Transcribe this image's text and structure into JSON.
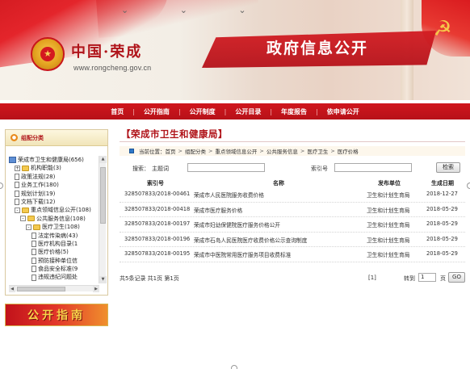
{
  "header": {
    "site_name": "中国·荣成",
    "site_url": "www.rongcheng.gov.cn",
    "banner_title": "政府信息公开"
  },
  "nav": [
    "首页",
    "公开指南",
    "公开制度",
    "公开目录",
    "年度报告",
    "依申请公开"
  ],
  "sidebar": {
    "title": "组配分类",
    "tree": [
      {
        "label": "荣成市卫生和健康局(656)",
        "icon": "root",
        "indent": 0
      },
      {
        "label": "机构职能(3)",
        "icon": "folder",
        "indent": 1,
        "exp": "+"
      },
      {
        "label": "政策法规(28)",
        "icon": "doc",
        "indent": 1
      },
      {
        "label": "业务工作(180)",
        "icon": "doc",
        "indent": 1
      },
      {
        "label": "规划计划(19)",
        "icon": "doc",
        "indent": 1
      },
      {
        "label": "文档下载(12)",
        "icon": "doc",
        "indent": 1
      },
      {
        "label": "重点领域信息公开(108)",
        "icon": "folder",
        "indent": 1,
        "exp": "-"
      },
      {
        "label": "公共服务信息(108)",
        "icon": "folder",
        "indent": 2,
        "exp": "-"
      },
      {
        "label": "医疗卫生(108)",
        "icon": "folder",
        "indent": 3,
        "exp": "-"
      },
      {
        "label": "法定传染病(43)",
        "icon": "doc",
        "indent": 4
      },
      {
        "label": "医疗机构目录(1",
        "icon": "doc",
        "indent": 4
      },
      {
        "label": "医疗价格(5)",
        "icon": "doc",
        "indent": 4
      },
      {
        "label": "预防接种单位信",
        "icon": "doc",
        "indent": 4
      },
      {
        "label": "食品安全标准(9",
        "icon": "doc",
        "indent": 4
      },
      {
        "label": "违规违纪问题处",
        "icon": "doc",
        "indent": 4
      }
    ],
    "guide_banner": "公开指南"
  },
  "main": {
    "title": "【荣成市卫生和健康局】",
    "breadcrumb": {
      "prefix": "当前位置：",
      "items": [
        "首页",
        "组配分类",
        "重点领域信息公开",
        "公共服务信息",
        "医疗卫生",
        "医疗价格"
      ]
    },
    "search": {
      "label": "搜索：",
      "subject_label": "主题词",
      "index_label": "索引号",
      "button": "检索"
    },
    "table": {
      "headers": [
        "索引号",
        "名称",
        "发布单位",
        "生成日期"
      ],
      "rows": [
        [
          "328507833/2018-00461",
          "荣成市人民医院服务收费价格",
          "卫生和计划生育局",
          "2018-12-27"
        ],
        [
          "328507833/2018-00418",
          "荣成市医疗服务价格",
          "卫生和计划生育局",
          "2018-05-29"
        ],
        [
          "328507833/2018-00197",
          "荣成市妇幼保健院医疗服务价格公开",
          "卫生和计划生育局",
          "2018-05-29"
        ],
        [
          "328507833/2018-00196",
          "荣成市石岛人民医院医疗收费价格公示查询制度",
          "卫生和计划生育局",
          "2018-05-29"
        ],
        [
          "328507833/2018-00195",
          "荣成市中医院常用医疗服务项目收费标准",
          "卫生和计划生育局",
          "2018-05-29"
        ]
      ]
    },
    "pager": {
      "info": "共5条记录 共1页 第1页",
      "pages": "[1]",
      "goto_label": "转到",
      "page_value": "1",
      "unit": "页",
      "go": "GO"
    }
  },
  "colors": {
    "brand_red": "#b0141a",
    "nav_red": "#c8141b",
    "gold": "#f6c64a"
  }
}
